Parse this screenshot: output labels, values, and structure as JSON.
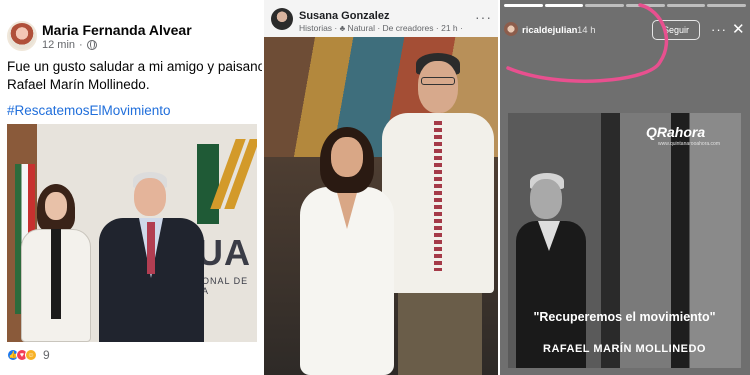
{
  "facebook_post": {
    "author": "Maria Fernanda Alvear",
    "time": "12 min",
    "meta_separator": "·",
    "text_line1": "Fue un gusto saludar a mi amigo y paisano",
    "text_line2": "Rafael Marín Mollinedo.",
    "hashtag": "#RescatemosElMovimiento",
    "photo_sign_large": "UA",
    "photo_sign_small": "ONAL DE A",
    "reaction_count": "9",
    "hashtag_color": "#216fdb"
  },
  "facebook_story": {
    "author": "Susana Gonzalez",
    "meta": "Historias · ♣ Natural · De creadores · 21 h ·",
    "more_icon": "···"
  },
  "instagram_story": {
    "username": "ricaldejulian",
    "time": "14 h",
    "follow_label": "Seguir",
    "more_icon": "···",
    "close_icon": "✕",
    "brand": "QRahora",
    "brand_sub": "www.quintanarooahora.com",
    "quote": "\"Recuperemos el movimiento\"",
    "name": "RAFAEL MARÍN MOLLINEDO",
    "annotation_color": "#e8508f"
  }
}
